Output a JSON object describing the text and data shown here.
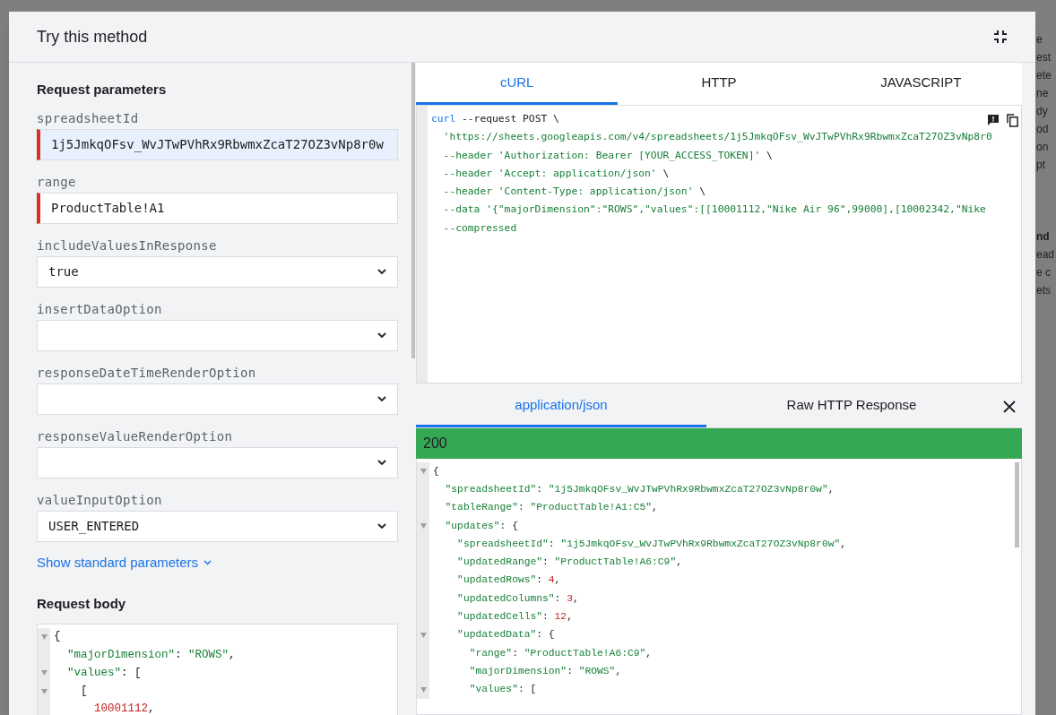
{
  "dialog": {
    "title": "Try this method"
  },
  "backdrop_fragments": [
    "e",
    "est",
    "ete",
    "ne",
    "dy",
    "od",
    "on",
    "pt",
    "nd",
    "ead",
    "e c",
    "ets"
  ],
  "request_parameters": {
    "heading": "Request parameters",
    "fields": [
      {
        "kind": "text",
        "label": "spreadsheetId",
        "value": "1j5JmkqOFsv_WvJTwPVhRx9RbwmxZcaT27OZ3vNp8r0w",
        "required": true,
        "autofilled": true
      },
      {
        "kind": "text",
        "label": "range",
        "value": "ProductTable!A1",
        "required": true,
        "autofilled": false
      },
      {
        "kind": "select",
        "label": "includeValuesInResponse",
        "value": "true"
      },
      {
        "kind": "select",
        "label": "insertDataOption"
      },
      {
        "kind": "select",
        "label": "responseDateTimeRenderOption"
      },
      {
        "kind": "select",
        "label": "responseValueRenderOption"
      },
      {
        "kind": "select",
        "label": "valueInputOption",
        "value": "USER_ENTERED"
      }
    ],
    "show_standard_link": "Show standard parameters"
  },
  "request_body": {
    "heading": "Request body",
    "lines": [
      {
        "fold": true,
        "tokens": [
          {
            "kind": "punct",
            "text": "{"
          }
        ]
      },
      {
        "fold": false,
        "tokens": [
          {
            "kind": "string",
            "text": "  \"majorDimension\""
          },
          {
            "kind": "punct",
            "text": ": "
          },
          {
            "kind": "string",
            "text": "\"ROWS\""
          },
          {
            "kind": "punct",
            "text": ","
          }
        ]
      },
      {
        "fold": true,
        "tokens": [
          {
            "kind": "string",
            "text": "  \"values\""
          },
          {
            "kind": "punct",
            "text": ": ["
          }
        ]
      },
      {
        "fold": true,
        "tokens": [
          {
            "kind": "punct",
            "text": "    ["
          }
        ]
      },
      {
        "fold": false,
        "tokens": [
          {
            "kind": "number",
            "text": "      10001112"
          },
          {
            "kind": "punct",
            "text": ","
          }
        ]
      }
    ]
  },
  "code_tabs": [
    {
      "label": "cURL",
      "selected": true
    },
    {
      "label": "HTTP",
      "selected": false
    },
    {
      "label": "JAVASCRIPT",
      "selected": false
    }
  ],
  "code_lines": [
    [
      {
        "kind": "keyword",
        "text": "curl"
      },
      {
        "kind": "punct",
        "text": " --request POST \\"
      }
    ],
    [
      {
        "kind": "string",
        "text": "  'https://sheets.googleapis.com/v4/spreadsheets/1j5JmkqOFsv_WvJTwPVhRx9RbwmxZcaT27OZ3vNp8r0"
      }
    ],
    [
      {
        "kind": "string",
        "text": "  --header 'Authorization: Bearer [YOUR_ACCESS_TOKEN]'"
      },
      {
        "kind": "punct",
        "text": " \\"
      }
    ],
    [
      {
        "kind": "string",
        "text": "  --header 'Accept: application/json'"
      },
      {
        "kind": "punct",
        "text": " \\"
      }
    ],
    [
      {
        "kind": "string",
        "text": "  --header 'Content-Type: application/json'"
      },
      {
        "kind": "punct",
        "text": " \\"
      }
    ],
    [
      {
        "kind": "string",
        "text": "  --data '{\"majorDimension\":\"ROWS\",\"values\":[[10001112,\"Nike Air 96\",99000],[10002342,\"Nike"
      }
    ],
    [
      {
        "kind": "string",
        "text": "  --compressed"
      }
    ]
  ],
  "response_tabs": [
    {
      "label": "application/json",
      "selected": true
    },
    {
      "label": "Raw HTTP Response",
      "selected": false
    }
  ],
  "response_status": {
    "code": "200",
    "kind": "success"
  },
  "response_lines": [
    {
      "fold": true,
      "tokens": [
        {
          "kind": "punct",
          "text": "{"
        }
      ]
    },
    {
      "fold": false,
      "tokens": [
        {
          "kind": "string",
          "text": "  \"spreadsheetId\""
        },
        {
          "kind": "punct",
          "text": ": "
        },
        {
          "kind": "string",
          "text": "\"1j5JmkqOFsv_WvJTwPVhRx9RbwmxZcaT27OZ3vNp8r0w\""
        },
        {
          "kind": "punct",
          "text": ","
        }
      ]
    },
    {
      "fold": false,
      "tokens": [
        {
          "kind": "string",
          "text": "  \"tableRange\""
        },
        {
          "kind": "punct",
          "text": ": "
        },
        {
          "kind": "string",
          "text": "\"ProductTable!A1:C5\""
        },
        {
          "kind": "punct",
          "text": ","
        }
      ]
    },
    {
      "fold": true,
      "tokens": [
        {
          "kind": "string",
          "text": "  \"updates\""
        },
        {
          "kind": "punct",
          "text": ": {"
        }
      ]
    },
    {
      "fold": false,
      "tokens": [
        {
          "kind": "string",
          "text": "    \"spreadsheetId\""
        },
        {
          "kind": "punct",
          "text": ": "
        },
        {
          "kind": "string",
          "text": "\"1j5JmkqOFsv_WvJTwPVhRx9RbwmxZcaT27OZ3vNp8r0w\""
        },
        {
          "kind": "punct",
          "text": ","
        }
      ]
    },
    {
      "fold": false,
      "tokens": [
        {
          "kind": "string",
          "text": "    \"updatedRange\""
        },
        {
          "kind": "punct",
          "text": ": "
        },
        {
          "kind": "string",
          "text": "\"ProductTable!A6:C9\""
        },
        {
          "kind": "punct",
          "text": ","
        }
      ]
    },
    {
      "fold": false,
      "tokens": [
        {
          "kind": "string",
          "text": "    \"updatedRows\""
        },
        {
          "kind": "punct",
          "text": ": "
        },
        {
          "kind": "number",
          "text": "4"
        },
        {
          "kind": "punct",
          "text": ","
        }
      ]
    },
    {
      "fold": false,
      "tokens": [
        {
          "kind": "string",
          "text": "    \"updatedColumns\""
        },
        {
          "kind": "punct",
          "text": ": "
        },
        {
          "kind": "number",
          "text": "3"
        },
        {
          "kind": "punct",
          "text": ","
        }
      ]
    },
    {
      "fold": false,
      "tokens": [
        {
          "kind": "string",
          "text": "    \"updatedCells\""
        },
        {
          "kind": "punct",
          "text": ": "
        },
        {
          "kind": "number",
          "text": "12"
        },
        {
          "kind": "punct",
          "text": ","
        }
      ]
    },
    {
      "fold": true,
      "tokens": [
        {
          "kind": "string",
          "text": "    \"updatedData\""
        },
        {
          "kind": "punct",
          "text": ": {"
        }
      ]
    },
    {
      "fold": false,
      "tokens": [
        {
          "kind": "string",
          "text": "      \"range\""
        },
        {
          "kind": "punct",
          "text": ": "
        },
        {
          "kind": "string",
          "text": "\"ProductTable!A6:C9\""
        },
        {
          "kind": "punct",
          "text": ","
        }
      ]
    },
    {
      "fold": false,
      "tokens": [
        {
          "kind": "string",
          "text": "      \"majorDimension\""
        },
        {
          "kind": "punct",
          "text": ": "
        },
        {
          "kind": "string",
          "text": "\"ROWS\""
        },
        {
          "kind": "punct",
          "text": ","
        }
      ]
    },
    {
      "fold": true,
      "tokens": [
        {
          "kind": "string",
          "text": "      \"values\""
        },
        {
          "kind": "punct",
          "text": ": ["
        }
      ]
    }
  ]
}
